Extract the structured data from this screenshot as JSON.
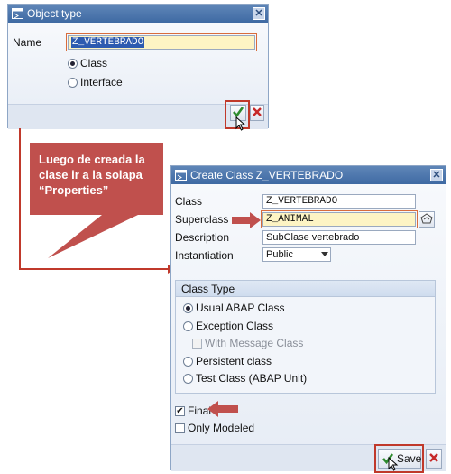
{
  "object_type_dialog": {
    "title": "Object type",
    "close_glyph": "✕",
    "name_label": "Name",
    "name_value": "Z_VERTEBRADO",
    "radio_class": "Class",
    "radio_interface": "Interface",
    "selected_radio": "Class"
  },
  "callout": {
    "text": "Luego de creada la clase ir a la solapa “Properties”",
    "color": "#c0504d"
  },
  "create_class_dialog": {
    "title": "Create Class Z_VERTEBRADO",
    "close_glyph": "✕",
    "fields": {
      "class_label": "Class",
      "class_value": "Z_VERTEBRADO",
      "superclass_label": "Superclass",
      "superclass_value": "Z_ANIMAL",
      "description_label": "Description",
      "description_value": "SubClase vertebrado",
      "instantiation_label": "Instantiation",
      "instantiation_value": "Public"
    },
    "class_type": {
      "title": "Class Type",
      "options": [
        "Usual ABAP Class",
        "Exception Class",
        "Persistent class",
        "Test Class (ABAP Unit)"
      ],
      "selected": "Usual ABAP Class",
      "with_message_class_label": "With Message Class"
    },
    "final_label": "Final",
    "final_checked": true,
    "only_modeled_label": "Only Modeled",
    "only_modeled_checked": false,
    "save_label": "Save"
  },
  "colors": {
    "accent_red": "#c0392b",
    "titlebar_blue": "#3f6aa3",
    "required_field": "#fdf4c4"
  }
}
